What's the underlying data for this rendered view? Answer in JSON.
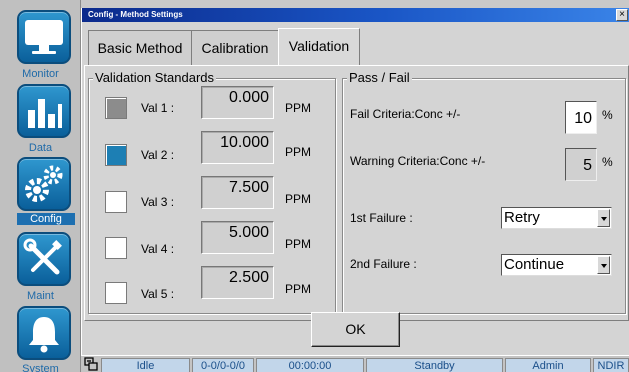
{
  "nav": [
    {
      "label": "Monitor",
      "icon": "monitor-icon",
      "active": false
    },
    {
      "label": "Data",
      "icon": "bar-chart-icon",
      "active": false
    },
    {
      "label": "Config",
      "icon": "gears-icon",
      "active": true
    },
    {
      "label": "Maint",
      "icon": "wrench-screwdriver-icon",
      "active": false
    },
    {
      "label": "System",
      "icon": "bell-icon",
      "active": false
    }
  ],
  "window": {
    "title": "Config - Method Settings",
    "close": "×"
  },
  "tabs": [
    {
      "label": "Basic Method",
      "active": false
    },
    {
      "label": "Calibration",
      "active": false
    },
    {
      "label": "Validation",
      "active": true
    }
  ],
  "validation": {
    "legend": "Validation Standards",
    "unit": "PPM",
    "rows": [
      {
        "label": "Val 1 :",
        "value": "0.000",
        "color": "#8c8c8c"
      },
      {
        "label": "Val 2 :",
        "value": "10.000",
        "color": "#1d7fb4"
      },
      {
        "label": "Val 3 :",
        "value": "7.500",
        "color": "#ffffff"
      },
      {
        "label": "Val 4 :",
        "value": "5.000",
        "color": "#ffffff"
      },
      {
        "label": "Val 5 :",
        "value": "2.500",
        "color": "#ffffff"
      }
    ]
  },
  "passfail": {
    "legend": "Pass / Fail",
    "fail_label": "Fail Criteria:Conc +/-",
    "fail_value": "10",
    "warn_label": "Warning Criteria:Conc +/-",
    "warn_value": "5",
    "pct": "%",
    "first_label": "1st Failure :",
    "first_value": "Retry",
    "second_label": "2nd Failure :",
    "second_value": "Continue"
  },
  "ok_label": "OK",
  "status": {
    "state": "Idle",
    "counts": "0-0/0-0/0",
    "time": "00:00:00",
    "mode": "Standby",
    "user": "Admin",
    "detector": "NDIR"
  },
  "colors": {
    "accent": "#1d6fb0",
    "title_bar": "#0b2a8c",
    "status_cell": "#c2d6ea"
  }
}
